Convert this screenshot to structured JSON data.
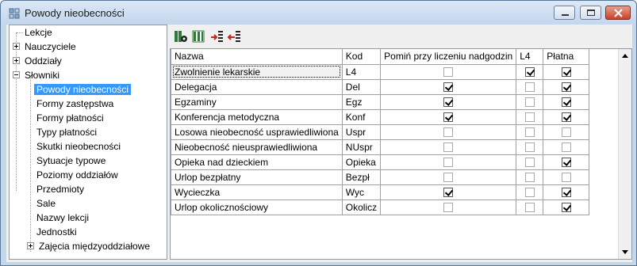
{
  "window": {
    "title": "Powody nieobecności"
  },
  "tree": {
    "items": [
      {
        "label": "Lekcje"
      },
      {
        "label": "Nauczyciele"
      },
      {
        "label": "Oddziały"
      },
      {
        "label": "Słowniki"
      },
      {
        "label": "Powody nieobecności"
      },
      {
        "label": "Formy zastępstwa"
      },
      {
        "label": "Formy płatności"
      },
      {
        "label": "Typy płatności"
      },
      {
        "label": "Skutki nieobecności"
      },
      {
        "label": "Sytuacje typowe"
      },
      {
        "label": "Poziomy oddziałów"
      },
      {
        "label": "Przedmioty"
      },
      {
        "label": "Sale"
      },
      {
        "label": "Nazwy lekcji"
      },
      {
        "label": "Jednostki"
      },
      {
        "label": "Zajęcia międzyoddziałowe"
      }
    ],
    "selected": "Powody nieobecności"
  },
  "toolbar": {
    "icons": [
      "columns-config-icon",
      "columns-icon",
      "import-icon",
      "export-icon"
    ]
  },
  "grid": {
    "columns": [
      "Nazwa",
      "Kod",
      "Pomiń przy liczeniu nadgodzin",
      "L4",
      "Płatna"
    ],
    "rows": [
      {
        "nazwa": "Zwolnienie lekarskie",
        "kod": "L4",
        "pomin": false,
        "l4": true,
        "platna": true
      },
      {
        "nazwa": "Delegacja",
        "kod": "Del",
        "pomin": true,
        "l4": false,
        "platna": true
      },
      {
        "nazwa": "Egzaminy",
        "kod": "Egz",
        "pomin": true,
        "l4": false,
        "platna": true
      },
      {
        "nazwa": "Konferencja metodyczna",
        "kod": "Konf",
        "pomin": true,
        "l4": false,
        "platna": true
      },
      {
        "nazwa": "Losowa nieobecność usprawiedliwiona",
        "kod": "Uspr",
        "pomin": false,
        "l4": false,
        "platna": false
      },
      {
        "nazwa": "Nieobecność nieusprawiedliwiona",
        "kod": "NUspr",
        "pomin": false,
        "l4": false,
        "platna": false
      },
      {
        "nazwa": "Opieka nad dzieckiem",
        "kod": "Opieka",
        "pomin": false,
        "l4": false,
        "platna": true
      },
      {
        "nazwa": "Urlop bezpłatny",
        "kod": "Bezpł",
        "pomin": false,
        "l4": false,
        "platna": false
      },
      {
        "nazwa": "Wycieczka",
        "kod": "Wyc",
        "pomin": true,
        "l4": false,
        "platna": true
      },
      {
        "nazwa": "Urlop okolicznościowy",
        "kod": "Okolicz",
        "pomin": false,
        "l4": false,
        "platna": true
      }
    ]
  },
  "colors": {
    "selection": "#3399ff",
    "window_frame": "#c4d6ea",
    "close_button": "#c9412a"
  }
}
